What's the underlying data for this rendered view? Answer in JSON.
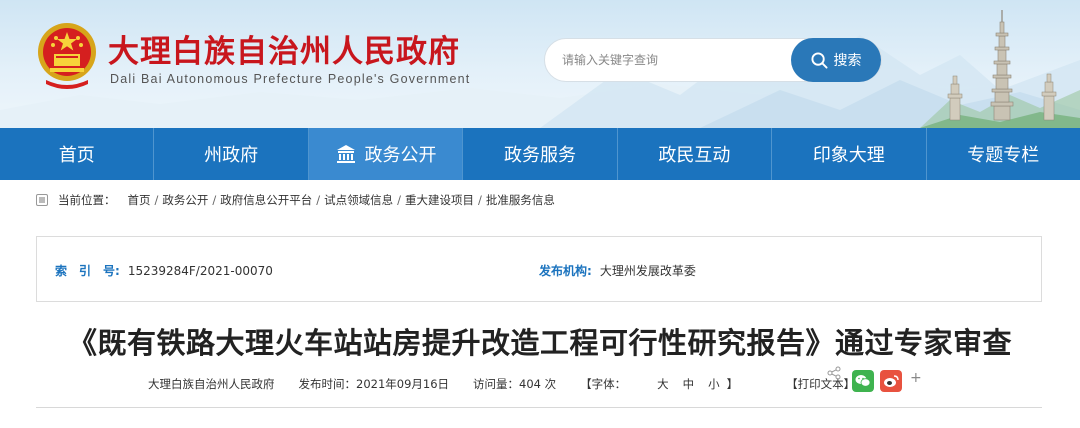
{
  "header": {
    "title": "大理白族自治州人民政府",
    "subtitle": "Dali Bai Autonomous Prefecture People's Government",
    "search": {
      "placeholder": "请输入关键字查询",
      "button_label": "搜索"
    }
  },
  "nav": {
    "items": [
      {
        "label": "首页"
      },
      {
        "label": "州政府"
      },
      {
        "label": "政务公开",
        "active": true
      },
      {
        "label": "政务服务"
      },
      {
        "label": "政民互动"
      },
      {
        "label": "印象大理"
      },
      {
        "label": "专题专栏"
      }
    ]
  },
  "breadcrumb": {
    "prefix": "当前位置：",
    "items": [
      "首页",
      "政务公开",
      "政府信息公开平台",
      "试点领域信息",
      "重大建设项目",
      "批准服务信息"
    ],
    "separator": "/"
  },
  "info": {
    "index_label": "索　引　号:",
    "index_value": "15239284F/2021-00070",
    "publisher_label": "发布机构:",
    "publisher_value": "大理州发展改革委"
  },
  "article": {
    "title": "《既有铁路大理火车站站房提升改造工程可行性研究报告》通过专家审查",
    "source": "大理白族自治州人民政府",
    "publish_time": "发布时间：2021年09月16日",
    "views": "访问量：404 次",
    "font_prefix": "【字体：",
    "font_large": "大",
    "font_medium": "中",
    "font_small": "小",
    "font_suffix": "】",
    "print": "【打印文本】",
    "share_more": "+"
  },
  "colors": {
    "brand_red": "#c8161d",
    "nav_blue": "#1b73be",
    "nav_active": "#3a8ad0",
    "search_blue": "#2a78b8"
  },
  "icons": [
    "national-emblem-icon",
    "search-icon",
    "temple-icon",
    "breadcrumb-icon",
    "share-icon",
    "wechat-icon",
    "weibo-icon"
  ]
}
